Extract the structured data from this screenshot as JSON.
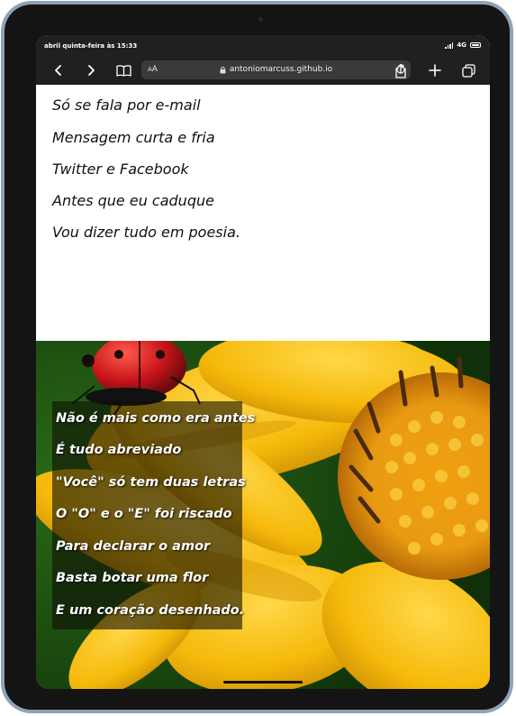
{
  "status_bar": {
    "time": "abril quinta-feira às 15:33",
    "network": "4G"
  },
  "browser": {
    "text_size_label": "AA",
    "url": "antoniomarcuss.github.io"
  },
  "poem_intro": [
    "Só se fala por e-mail",
    "Mensagem curta e fria",
    "Twitter e Facebook",
    "Antes que eu caduque",
    "Vou dizer tudo em poesia."
  ],
  "poem_overlay": [
    "Não é mais como era antes",
    "É tudo abreviado",
    "\"Você\" só tem duas letras",
    "O \"O\" e o \"E\" foi riscado",
    "Para declarar o amor",
    "Basta botar uma flor",
    "E um coração desenhado."
  ],
  "icons": {
    "back": "chevron-left-icon",
    "forward": "chevron-right-icon",
    "bookmarks": "book-icon",
    "lock": "lock-icon",
    "reload": "reload-icon",
    "share": "share-icon",
    "new_tab": "plus-icon",
    "tabs": "tabs-icon"
  },
  "colors": {
    "browser_chrome": "#1f2022",
    "address_bar": "#3a3a3c",
    "device_frame": "#8da3b8",
    "petal_yellow": "#f5b90a",
    "leaf_green": "#1e4a12",
    "ladybug_red": "#c8151b"
  }
}
